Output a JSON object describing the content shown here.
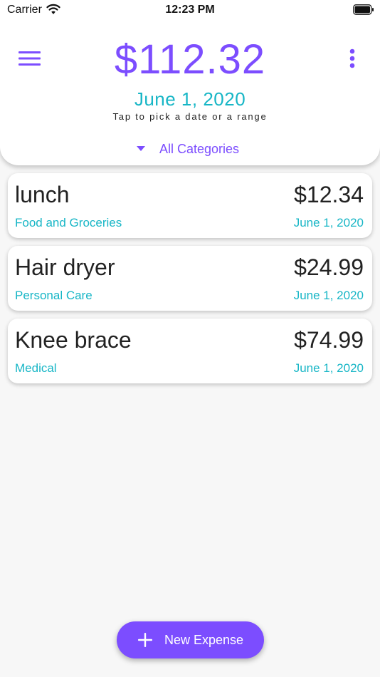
{
  "status_bar": {
    "carrier": "Carrier",
    "time": "12:23 PM"
  },
  "header": {
    "total": "$112.32",
    "date": "June 1, 2020",
    "hint": "Tap to pick a date or a range",
    "category_filter": "All Categories"
  },
  "expenses": [
    {
      "name": "lunch",
      "amount": "$12.34",
      "category": "Food and Groceries",
      "date": "June 1, 2020"
    },
    {
      "name": "Hair dryer",
      "amount": "$24.99",
      "category": "Personal Care",
      "date": "June 1, 2020"
    },
    {
      "name": "Knee brace",
      "amount": "$74.99",
      "category": "Medical",
      "date": "June 1, 2020"
    }
  ],
  "fab": {
    "label": "New Expense"
  },
  "colors": {
    "accent": "#7c4dff",
    "secondary": "#17b6c6",
    "background": "#f7f7f7",
    "card": "#ffffff"
  },
  "icons": {
    "menu": "menu-icon",
    "more": "more-vert-icon",
    "caret": "caret-down-icon",
    "plus": "plus-icon",
    "wifi": "wifi-icon",
    "battery": "battery-icon"
  }
}
